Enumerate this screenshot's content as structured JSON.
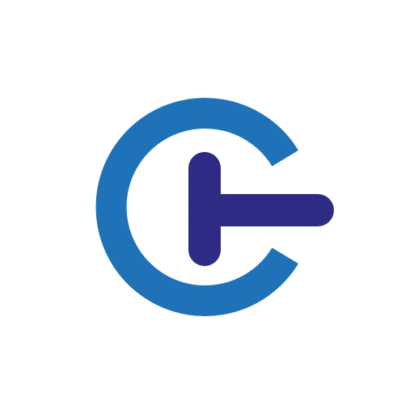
{
  "logo": {
    "icon": "power-button-c-logo",
    "colors": {
      "background": "#ffffff",
      "ring": "#1f72b8",
      "bar": "#2e2b84"
    }
  }
}
